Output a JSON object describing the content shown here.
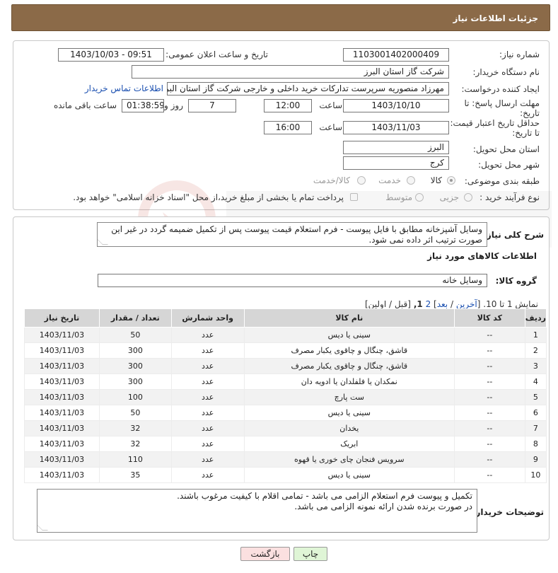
{
  "title": "جزئیات اطلاعات نیاز",
  "need_number": {
    "label": "شماره نیاز:",
    "value": "1103001402000409"
  },
  "announce": {
    "label": "تاریخ و ساعت اعلان عمومی:",
    "value": "1403/10/03 - 09:51"
  },
  "buyer_org": {
    "label": "نام دستگاه خریدار:",
    "value": "شرکت گاز استان البرز"
  },
  "requester": {
    "label": "ایجاد کننده درخواست:",
    "value": "مهرزاد منصوریه سرپرست تدارکات خرید داخلی و خارجی شرکت گاز استان البرز",
    "link": "اطلاعات تماس خریدار"
  },
  "deadline": {
    "label": "مهلت ارسال پاسخ: تا تاریخ:",
    "date": "1403/10/10",
    "time_label": "ساعت",
    "time": "12:00",
    "days": "7",
    "days_label": "روز و",
    "remaining": "01:38:59",
    "remaining_label": "ساعت باقی مانده"
  },
  "validity": {
    "label": "حداقل تاریخ اعتبار قیمت: تا تاریخ:",
    "date": "1403/11/03",
    "time_label": "ساعت",
    "time": "16:00"
  },
  "province": {
    "label": "استان محل تحویل:",
    "value": "البرز"
  },
  "city": {
    "label": "شهر محل تحویل:",
    "value": "کرج"
  },
  "category": {
    "label": "طبقه بندی موضوعی:",
    "options": [
      "کالا",
      "خدمت",
      "کالا/خدمت"
    ],
    "selected": "کالا"
  },
  "purchase_type": {
    "label": "نوع فرآیند خرید :",
    "options": [
      "جزیی",
      "متوسط"
    ],
    "note": "پرداخت تمام یا بخشی از مبلغ خرید،از محل \"اسناد خزانه اسلامی\" خواهد بود."
  },
  "description": {
    "label": "شرح کلی نیاز:",
    "value": "وسایل آشپزخانه مطابق با فایل پیوست - فرم استعلام قیمت پیوست پس از تکمیل ضمیمه گردد در غیر این صورت ترتیب اثر داده نمی شود."
  },
  "goods_info_title": "اطلاعات کالاهای مورد نیاز",
  "goods_group": {
    "label": "گروه کالا:",
    "value": "وسایل خانه"
  },
  "pagination": {
    "text_prefix": "نمایش 1 تا 10.",
    "links_open": "[",
    "last": "آخرین",
    "sep1": "/",
    "next": "بعد",
    "sep2": "]",
    "page2": "2",
    "page1": "1,",
    "prev_first": "[قبل / اولین]"
  },
  "table": {
    "headers": [
      "ردیف",
      "کد کالا",
      "نام کالا",
      "واحد شمارش",
      "تعداد / مقدار",
      "تاریخ نیاز"
    ],
    "rows": [
      [
        "1",
        "--",
        "سینی یا دیس",
        "عدد",
        "50",
        "1403/11/03"
      ],
      [
        "2",
        "--",
        "قاشق، چنگال و چاقوی یکبار مصرف",
        "عدد",
        "300",
        "1403/11/03"
      ],
      [
        "3",
        "--",
        "قاشق، چنگال و چاقوی یکبار مصرف",
        "عدد",
        "300",
        "1403/11/03"
      ],
      [
        "4",
        "--",
        "نمکدان یا فلفلدان یا ادویه دان",
        "عدد",
        "300",
        "1403/11/03"
      ],
      [
        "5",
        "--",
        "ست پارچ",
        "عدد",
        "100",
        "1403/11/03"
      ],
      [
        "6",
        "--",
        "سینی یا دیس",
        "عدد",
        "50",
        "1403/11/03"
      ],
      [
        "7",
        "--",
        "یخدان",
        "عدد",
        "32",
        "1403/11/03"
      ],
      [
        "8",
        "--",
        "ابریک",
        "عدد",
        "32",
        "1403/11/03"
      ],
      [
        "9",
        "--",
        "سرویس فنجان چای خوری یا قهوه",
        "عدد",
        "110",
        "1403/11/03"
      ],
      [
        "10",
        "--",
        "سینی یا دیس",
        "عدد",
        "35",
        "1403/11/03"
      ]
    ]
  },
  "buyer_notes": {
    "label": "توضیحات خریدار:",
    "line1": "تکمیل و پیوست فرم استعلام الزامی می باشد - تمامی اقلام با کیفیت مرغوب باشند.",
    "line2": "در صورت برنده شدن ارائه نمونه الزامی می باشد."
  },
  "buttons": {
    "print": "چاپ",
    "back": "بازگشت"
  },
  "colors": {
    "titlebar": "#8b6a48",
    "print_btn": "#dff5d6",
    "back_btn": "#fbe0e0"
  }
}
